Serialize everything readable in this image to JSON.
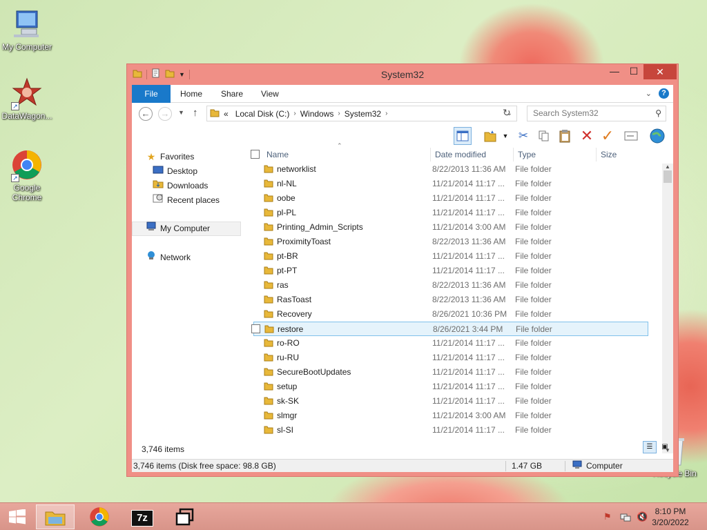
{
  "desktop": {
    "icons": [
      {
        "label": "My Computer",
        "icon": "my-computer-icon"
      },
      {
        "label": "DataWagon...",
        "icon": "datawagon-icon"
      },
      {
        "label": "Google Chrome",
        "icon": "chrome-icon"
      },
      {
        "label": "Recycle Bin",
        "icon": "recycle-bin-icon"
      }
    ]
  },
  "window": {
    "title": "System32",
    "controls": {
      "minimize": "—",
      "maximize": "☐",
      "close": "✕"
    },
    "ribbon": {
      "tabs": [
        "File",
        "Home",
        "Share",
        "View"
      ],
      "help": "?"
    },
    "address": {
      "prefix": "«",
      "crumbs": [
        "Local Disk (C:)",
        "Windows",
        "System32"
      ],
      "search_placeholder": "Search System32"
    },
    "nav_pane": {
      "favorites": "Favorites",
      "favorites_items": [
        "Desktop",
        "Downloads",
        "Recent places"
      ],
      "my_computer": "My Computer",
      "network": "Network"
    },
    "columns": {
      "name": "Name",
      "date": "Date modified",
      "type": "Type",
      "size": "Size"
    },
    "files": [
      {
        "name": "networklist",
        "date": "8/22/2013 11:36 AM",
        "type": "File folder"
      },
      {
        "name": "nl-NL",
        "date": "11/21/2014 11:17 ...",
        "type": "File folder"
      },
      {
        "name": "oobe",
        "date": "11/21/2014 11:17 ...",
        "type": "File folder"
      },
      {
        "name": "pl-PL",
        "date": "11/21/2014 11:17 ...",
        "type": "File folder"
      },
      {
        "name": "Printing_Admin_Scripts",
        "date": "11/21/2014 3:00 AM",
        "type": "File folder"
      },
      {
        "name": "ProximityToast",
        "date": "8/22/2013 11:36 AM",
        "type": "File folder"
      },
      {
        "name": "pt-BR",
        "date": "11/21/2014 11:17 ...",
        "type": "File folder"
      },
      {
        "name": "pt-PT",
        "date": "11/21/2014 11:17 ...",
        "type": "File folder"
      },
      {
        "name": "ras",
        "date": "8/22/2013 11:36 AM",
        "type": "File folder"
      },
      {
        "name": "RasToast",
        "date": "8/22/2013 11:36 AM",
        "type": "File folder"
      },
      {
        "name": "Recovery",
        "date": "8/26/2021 10:36 PM",
        "type": "File folder"
      },
      {
        "name": "restore",
        "date": "8/26/2021 3:44 PM",
        "type": "File folder",
        "selected": true
      },
      {
        "name": "ro-RO",
        "date": "11/21/2014 11:17 ...",
        "type": "File folder"
      },
      {
        "name": "ru-RU",
        "date": "11/21/2014 11:17 ...",
        "type": "File folder"
      },
      {
        "name": "SecureBootUpdates",
        "date": "11/21/2014 11:17 ...",
        "type": "File folder"
      },
      {
        "name": "setup",
        "date": "11/21/2014 11:17 ...",
        "type": "File folder"
      },
      {
        "name": "sk-SK",
        "date": "11/21/2014 11:17 ...",
        "type": "File folder"
      },
      {
        "name": "slmgr",
        "date": "11/21/2014 3:00 AM",
        "type": "File folder"
      },
      {
        "name": "sl-SI",
        "date": "11/21/2014 11:17 ...",
        "type": "File folder"
      }
    ],
    "item_count": "3,746 items",
    "status": {
      "items": "3,746 items (Disk free space: 98.8 GB)",
      "size": "1.47 GB",
      "location": "Computer"
    }
  },
  "taskbar": {
    "buttons": [
      "start-icon",
      "file-explorer-icon",
      "chrome-icon",
      "7zip-icon",
      "task-switch-icon"
    ],
    "sevenzip_label": "7z",
    "time": "8:10 PM",
    "date": "3/20/2022"
  },
  "colors": {
    "window_frame": "#f08f86",
    "accent": "#1979ca",
    "selection": "#e5f3fb",
    "close_button": "#c7463c"
  }
}
